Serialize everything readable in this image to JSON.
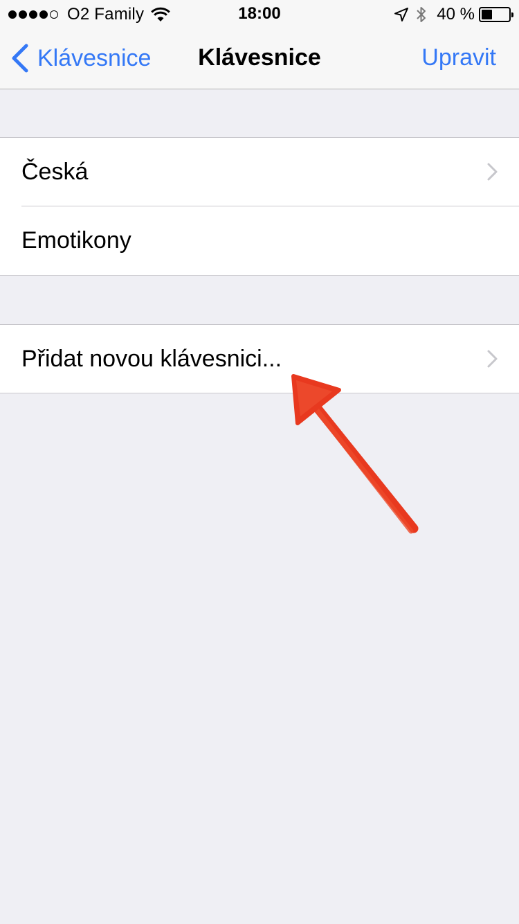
{
  "status_bar": {
    "carrier": "O2 Family",
    "time": "18:00",
    "battery_text": "40 %",
    "battery_level": 0.4,
    "signal_strength": 4,
    "signal_max": 5
  },
  "nav": {
    "back_label": "Klávesnice",
    "title": "Klávesnice",
    "edit_label": "Upravit"
  },
  "keyboards": {
    "items": [
      {
        "label": "Česká",
        "has_chevron": true
      },
      {
        "label": "Emotikony",
        "has_chevron": false
      }
    ]
  },
  "add_keyboard": {
    "label": "Přidat novou klávesnici..."
  },
  "colors": {
    "accent": "#3478f6",
    "background": "#efeff4",
    "annotation": "#e8391f"
  },
  "icons": [
    "wifi-icon",
    "location-arrow-icon",
    "bluetooth-icon",
    "battery-icon",
    "chevron-left-icon",
    "chevron-right-icon"
  ]
}
